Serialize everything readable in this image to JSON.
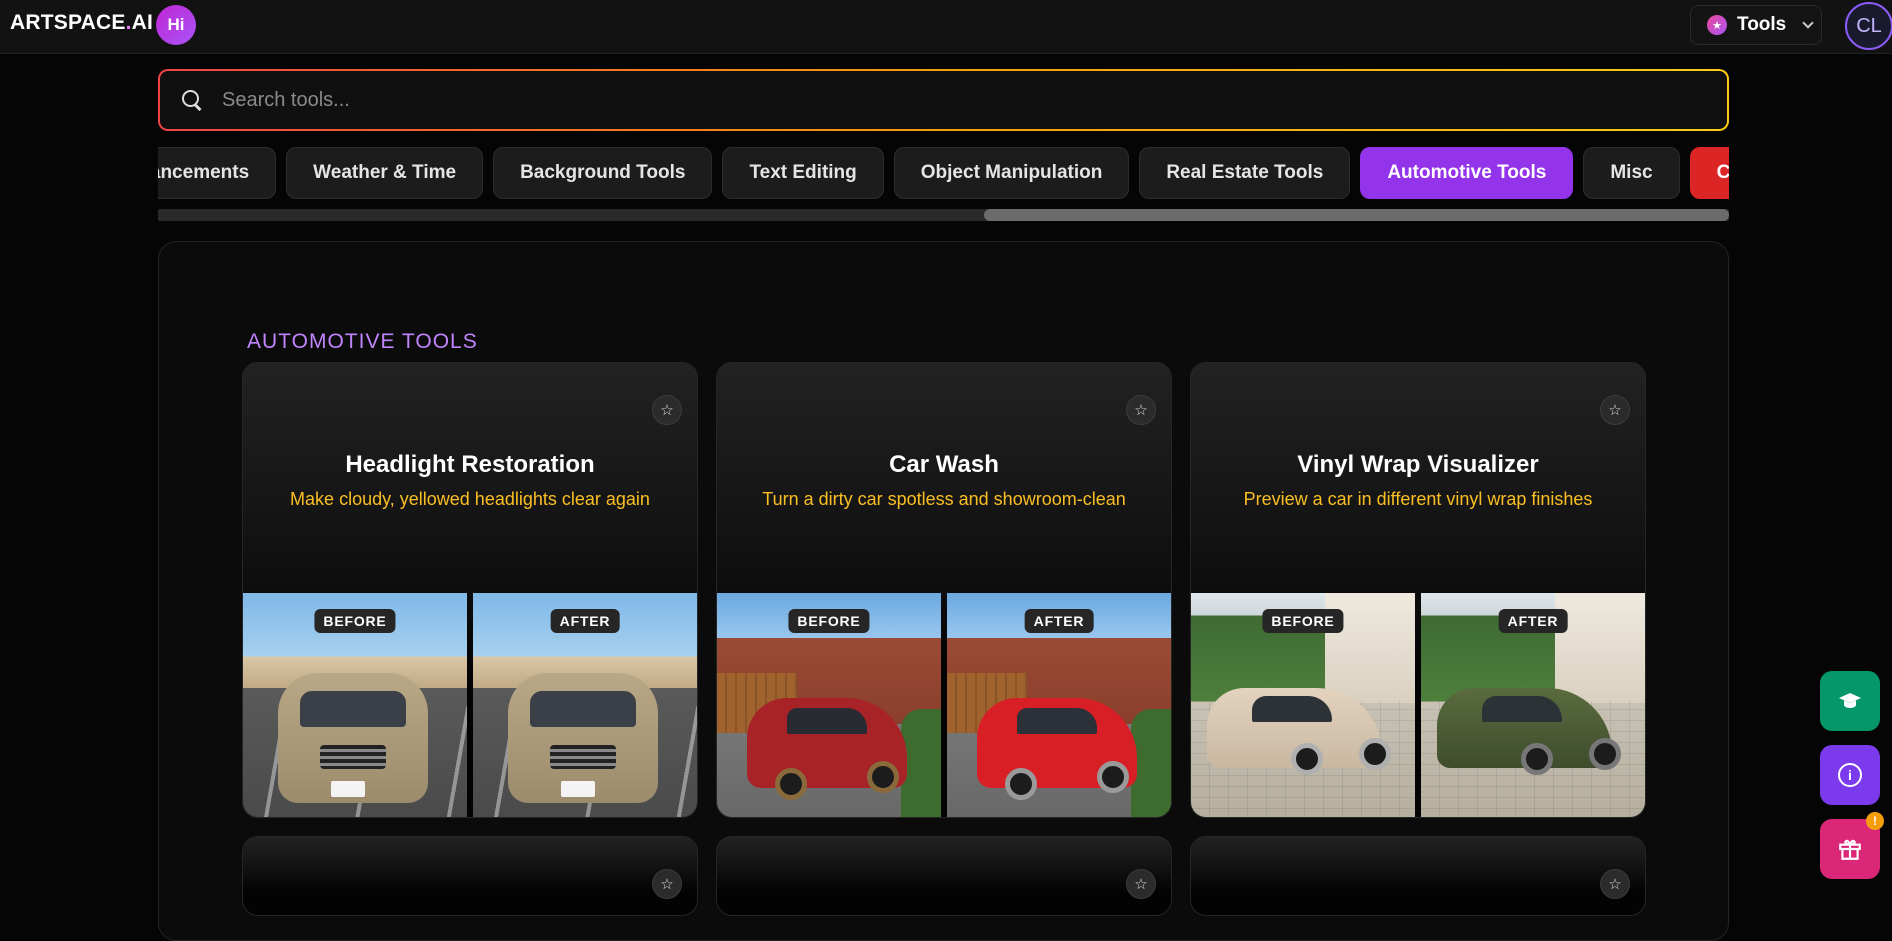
{
  "header": {
    "logo_main": "ARTSPACE",
    "logo_dot": ".",
    "logo_suffix": "AI",
    "hi_badge": "Hi",
    "tools_label": "Tools",
    "avatar_initials": "CL"
  },
  "search": {
    "placeholder": "Search tools..."
  },
  "filters": [
    {
      "label": "Enhancements",
      "active": false
    },
    {
      "label": "Weather & Time",
      "active": false
    },
    {
      "label": "Background Tools",
      "active": false
    },
    {
      "label": "Text Editing",
      "active": false
    },
    {
      "label": "Object Manipulation",
      "active": false
    },
    {
      "label": "Real Estate Tools",
      "active": false
    },
    {
      "label": "Automotive Tools",
      "active": true
    },
    {
      "label": "Misc",
      "active": false
    }
  ],
  "clear_filters_label": "Clear Filters",
  "section": {
    "title": "AUTOMOTIVE TOOLS"
  },
  "cards": [
    {
      "title": "Headlight Restoration",
      "subtitle": "Make cloudy, yellowed headlights clear again",
      "before_label": "BEFORE",
      "after_label": "AFTER"
    },
    {
      "title": "Car Wash",
      "subtitle": "Turn a dirty car spotless and showroom-clean",
      "before_label": "BEFORE",
      "after_label": "AFTER"
    },
    {
      "title": "Vinyl Wrap Visualizer",
      "subtitle": "Preview a car in different vinyl wrap finishes",
      "before_label": "BEFORE",
      "after_label": "AFTER"
    }
  ],
  "icons": {
    "favorite": "☆",
    "learn": "graduation-cap-icon",
    "info": "i",
    "gift": "gift-icon",
    "notification_badge": "!"
  },
  "colors": {
    "accent_purple": "#9333ea",
    "clear_red": "#dc2626",
    "subtitle_yellow": "#fbbf24",
    "section_title": "#c084fc"
  }
}
